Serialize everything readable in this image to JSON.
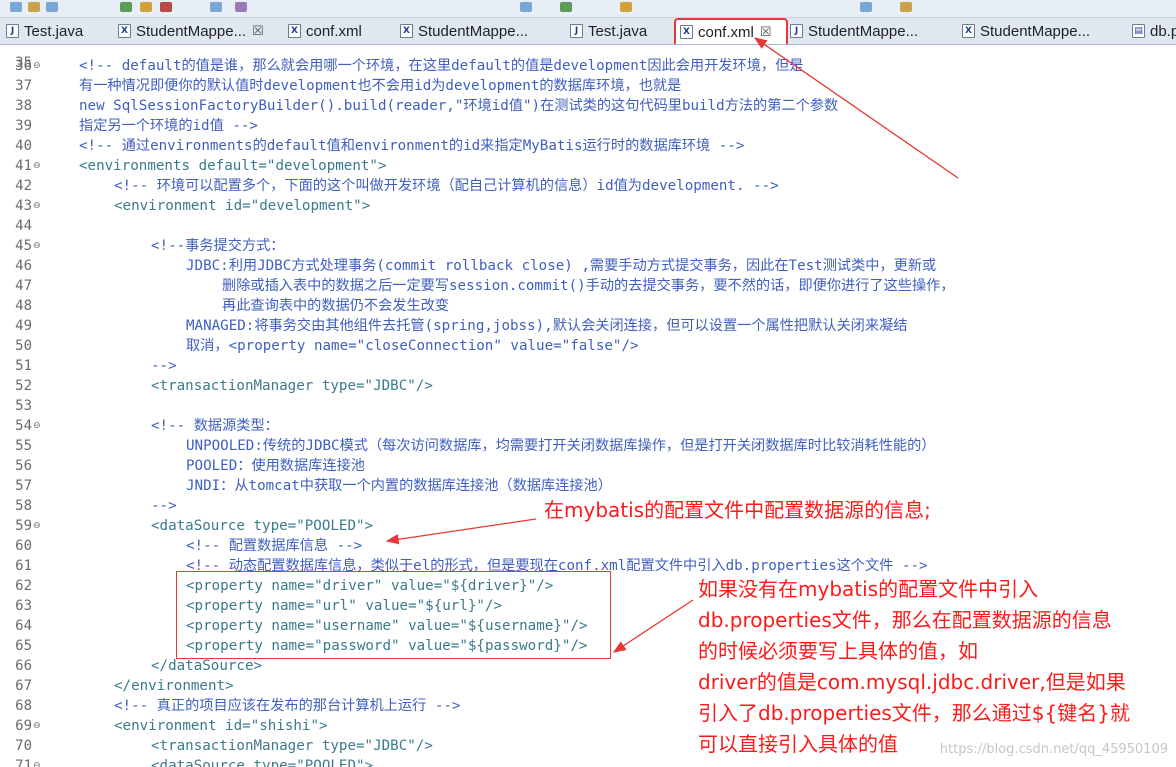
{
  "tabs": [
    {
      "label": "Test.java",
      "icon": "J",
      "active": false
    },
    {
      "label": "StudentMappe...",
      "icon": "X",
      "active": false,
      "close": "☒"
    },
    {
      "label": "conf.xml",
      "icon": "X",
      "active": false
    },
    {
      "label": "StudentMappe...",
      "icon": "X",
      "active": false
    },
    {
      "label": "Test.java",
      "icon": "J",
      "active": false
    },
    {
      "label": "conf.xml",
      "icon": "X",
      "active": true,
      "close": "☒"
    },
    {
      "label": "StudentMappe...",
      "icon": "J",
      "active": false
    },
    {
      "label": "StudentMappe...",
      "icon": "X",
      "active": false
    },
    {
      "label": "db.p",
      "icon": "▤",
      "active": false
    }
  ],
  "editor": {
    "partial_top_line": "35",
    "lines": [
      {
        "n": "36",
        "fold": "⊖",
        "text": "<!-- default的值是谁，那么就会用哪一个环境，在这里default的值是development因此会用开发环境，但是"
      },
      {
        "n": "37",
        "fold": "",
        "text": "有一种情况即便你的默认值时development也不会用id为development的数据库环境，也就是"
      },
      {
        "n": "38",
        "fold": "",
        "text": "new SqlSessionFactoryBuilder().build(reader,\"环境id值\")在测试类的这句代码里build方法的第二个参数"
      },
      {
        "n": "39",
        "fold": "",
        "text": "指定另一个环境的id值 -->"
      },
      {
        "n": "40",
        "fold": "",
        "text": "<!-- 通过environments的default值和environment的id来指定MyBatis运行时的数据库环境 -->"
      },
      {
        "n": "41",
        "fold": "⊖",
        "text": "<environments default=\"development\">"
      },
      {
        "n": "42",
        "fold": "",
        "text": "<!-- 环境可以配置多个，下面的这个叫做开发环境（配自己计算机的信息）id值为development. -->"
      },
      {
        "n": "43",
        "fold": "⊖",
        "text": "<environment id=\"development\">"
      },
      {
        "n": "44",
        "fold": "",
        "text": ""
      },
      {
        "n": "45",
        "fold": "⊖",
        "text": "<!--事务提交方式："
      },
      {
        "n": "46",
        "fold": "",
        "text": "JDBC:利用JDBC方式处理事务(commit rollback close) ,需要手动方式提交事务，因此在Test测试类中，更新或"
      },
      {
        "n": "47",
        "fold": "",
        "text": "删除或插入表中的数据之后一定要写session.commit()手动的去提交事务，要不然的话，即便你进行了这些操作，"
      },
      {
        "n": "48",
        "fold": "",
        "text": "再此查询表中的数据仍不会发生改变"
      },
      {
        "n": "49",
        "fold": "",
        "text": "MANAGED:将事务交由其他组件去托管(spring,jobss),默认会关闭连接，但可以设置一个属性把默认关闭来凝结"
      },
      {
        "n": "50",
        "fold": "",
        "text": "取消，<property name=\"closeConnection\" value=\"false\"/>"
      },
      {
        "n": "51",
        "fold": "",
        "text": "-->"
      },
      {
        "n": "52",
        "fold": "",
        "text": "<transactionManager type=\"JDBC\"/>"
      },
      {
        "n": "53",
        "fold": "",
        "text": ""
      },
      {
        "n": "54",
        "fold": "⊖",
        "text": "<!-- 数据源类型："
      },
      {
        "n": "55",
        "fold": "",
        "text": "UNPOOLED:传统的JDBC模式（每次访问数据库，均需要打开关闭数据库操作，但是打开关闭数据库时比较消耗性能的）"
      },
      {
        "n": "56",
        "fold": "",
        "text": "POOLED：使用数据库连接池"
      },
      {
        "n": "57",
        "fold": "",
        "text": "JNDI：从tomcat中获取一个内置的数据库连接池（数据库连接池）"
      },
      {
        "n": "58",
        "fold": "",
        "text": "-->"
      },
      {
        "n": "59",
        "fold": "⊖",
        "text": "<dataSource type=\"POOLED\">"
      },
      {
        "n": "60",
        "fold": "",
        "text": "<!-- 配置数据库信息 -->"
      },
      {
        "n": "61",
        "fold": "",
        "text": "<!-- 动态配置数据库信息，类似于el的形式，但是要现在conf.xml配置文件中引入db.properties这个文件 -->"
      },
      {
        "n": "62",
        "fold": "",
        "text": "<property name=\"driver\" value=\"${driver}\"/>"
      },
      {
        "n": "63",
        "fold": "",
        "text": "<property name=\"url\" value=\"${url}\"/>"
      },
      {
        "n": "64",
        "fold": "",
        "text": "<property name=\"username\" value=\"${username}\"/>"
      },
      {
        "n": "65",
        "fold": "",
        "text": "<property name=\"password\" value=\"${password}\"/>"
      },
      {
        "n": "66",
        "fold": "",
        "text": "</dataSource>"
      },
      {
        "n": "67",
        "fold": "",
        "text": "</environment>"
      },
      {
        "n": "68",
        "fold": "",
        "text": "<!-- 真正的项目应该在发布的那台计算机上运行 -->"
      },
      {
        "n": "69",
        "fold": "⊖",
        "text": "<environment id=\"shishi\">"
      },
      {
        "n": "70",
        "fold": "",
        "text": "<transactionManager type=\"JDBC\"/>"
      },
      {
        "n": "71",
        "fold": "⊖",
        "text": "<dataSource type=\"POOLED\">"
      }
    ]
  },
  "annotations": {
    "top": "在mybatis的配置文件中配置数据源的信息;",
    "bottom_lines": [
      "如果没有在mybatis的配置文件中引入",
      "db.properties文件，那么在配置数据源的信息",
      "的时候必须要写上具体的值，如",
      "driver的值是com.mysql.jdbc.driver,但是如果",
      "引入了db.properties文件，那么通过${键名}就",
      "可以直接引入具体的值"
    ]
  },
  "watermark": "https://blog.csdn.net/qq_45950109",
  "colors": {
    "comment": "#3f5fbf",
    "tag": "#3a7a8c",
    "attribute": "#7f007f",
    "value": "#2a00ff",
    "annotation": "#ff1a1a"
  }
}
